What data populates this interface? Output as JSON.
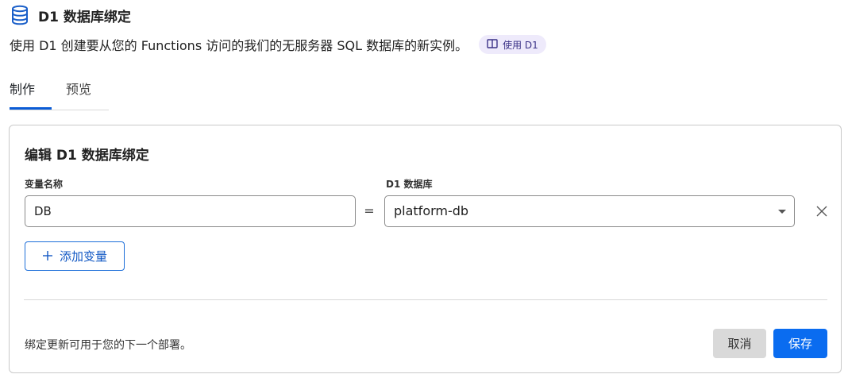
{
  "header": {
    "title": "D1 数据库绑定",
    "icon": "database-icon",
    "subtitle": "使用 D1 创建要从您的 Functions 访问的我们的无服务器 SQL 数据库的新实例。",
    "docs_link": {
      "label": "使用 D1",
      "icon": "book-icon"
    }
  },
  "tabs": [
    {
      "label": "制作",
      "active": true
    },
    {
      "label": "预览",
      "active": false
    }
  ],
  "card": {
    "title": "编辑 D1 数据库绑定",
    "variable_label": "变量名称",
    "database_label": "D1 数据库",
    "binding": {
      "variable_value": "DB",
      "equals": "=",
      "database_value": "platform-db"
    },
    "add_variable_label": "添加变量",
    "footnote": "绑定更新可用于您的下一个部署。",
    "cancel_label": "取消",
    "save_label": "保存"
  },
  "colors": {
    "accent": "#0a6cf0",
    "tab_underline": "#0b5cd6",
    "pill_bg": "#eeeafb",
    "icon_blue": "#1a5fc9"
  }
}
